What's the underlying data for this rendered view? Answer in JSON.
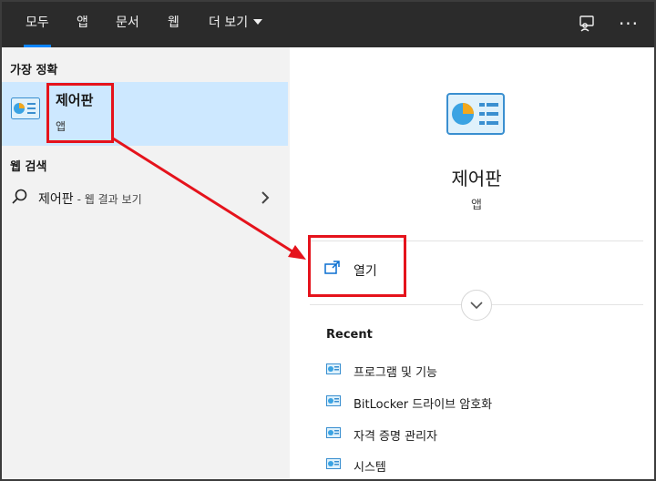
{
  "tabs": [
    {
      "label": "모두"
    },
    {
      "label": "앱"
    },
    {
      "label": "문서"
    },
    {
      "label": "웹"
    },
    {
      "label": "더 보기"
    }
  ],
  "topbar": {
    "feedback_icon": "feedback-icon",
    "more_icon": "ellipsis-icon"
  },
  "left": {
    "best_match_title": "가장 정확",
    "best": {
      "name": "제어판",
      "type": "앱",
      "icon": "control-panel-icon"
    },
    "web_title": "웹 검색",
    "web": {
      "term": "제어판",
      "suffix": "- 웹 결과 보기",
      "icon": "search-icon"
    }
  },
  "right": {
    "title": "제어판",
    "type": "앱",
    "open_label": "열기",
    "recent_title": "Recent",
    "recent": [
      {
        "label": "프로그램 및 기능"
      },
      {
        "label": "BitLocker 드라이브 암호화"
      },
      {
        "label": "자격 증명 관리자"
      },
      {
        "label": "시스템"
      }
    ]
  },
  "colors": {
    "topbar": "#2b2b2b",
    "accent": "#0a84ff",
    "selection": "#cde8ff",
    "annotation": "#e5131c"
  }
}
